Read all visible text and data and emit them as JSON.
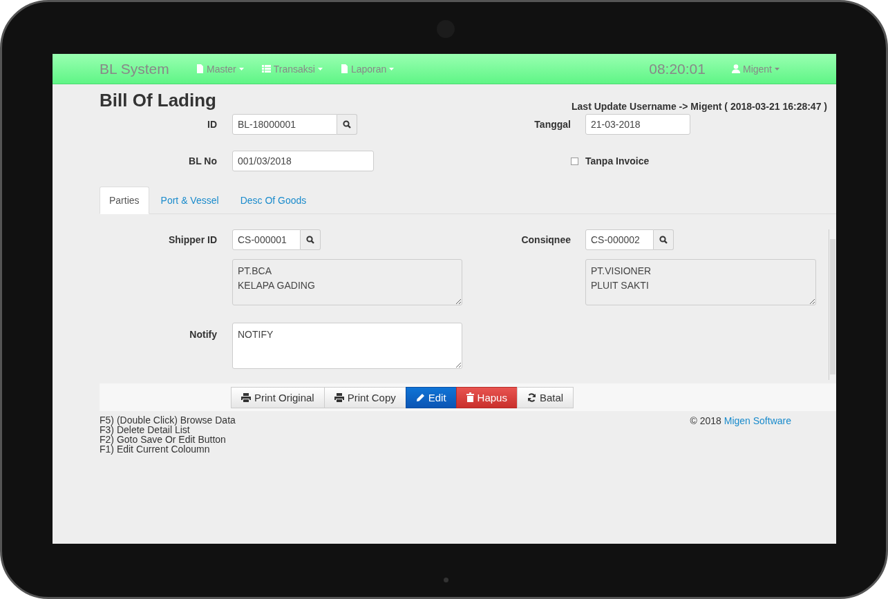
{
  "navbar": {
    "brand": "BL System",
    "menus": [
      {
        "label": "Master"
      },
      {
        "label": "Transaksi"
      },
      {
        "label": "Laporan"
      }
    ],
    "clock": "08:20:01",
    "user": "Migent"
  },
  "header": {
    "title": "Bill Of Lading",
    "last_update": "Last Update Username -> Migent ( 2018-03-21 16:28:47 )"
  },
  "fields": {
    "id": {
      "label": "ID",
      "value": "BL-18000001"
    },
    "tanggal": {
      "label": "Tanggal",
      "value": "21-03-2018"
    },
    "bl_no": {
      "label": "BL No",
      "value": "001/03/2018"
    },
    "tanpa_invoice": {
      "label": "Tanpa Invoice",
      "checked": false
    }
  },
  "tabs": [
    {
      "label": "Parties",
      "selected": true
    },
    {
      "label": "Port & Vessel",
      "selected": false
    },
    {
      "label": "Desc Of Goods",
      "selected": false
    }
  ],
  "parties": {
    "shipper": {
      "label": "Shipper ID",
      "value": "CS-000001",
      "address": "PT.BCA\nKELAPA GADING",
      "readonly": true
    },
    "consignee": {
      "label": "Consiqnee",
      "value": "CS-000002",
      "address": "PT.VISIONER\nPLUIT SAKTI",
      "readonly": true
    },
    "notify": {
      "label": "Notify",
      "value": "NOTIFY",
      "readonly": false
    }
  },
  "buttons": [
    {
      "label": "Print Original",
      "kind": "default"
    },
    {
      "label": "Print Copy",
      "kind": "default"
    },
    {
      "label": "Edit",
      "kind": "primary"
    },
    {
      "label": "Hapus",
      "kind": "danger"
    },
    {
      "label": "Batal",
      "kind": "default"
    }
  ],
  "shortcuts": [
    "F5) (Double Click) Browse Data",
    "F3) Delete Detail List",
    "F2) Goto Save Or Edit Button",
    "F1) Edit Current Coloumn"
  ],
  "footer": {
    "copyright": "© 2018",
    "link": "Migen Software"
  }
}
